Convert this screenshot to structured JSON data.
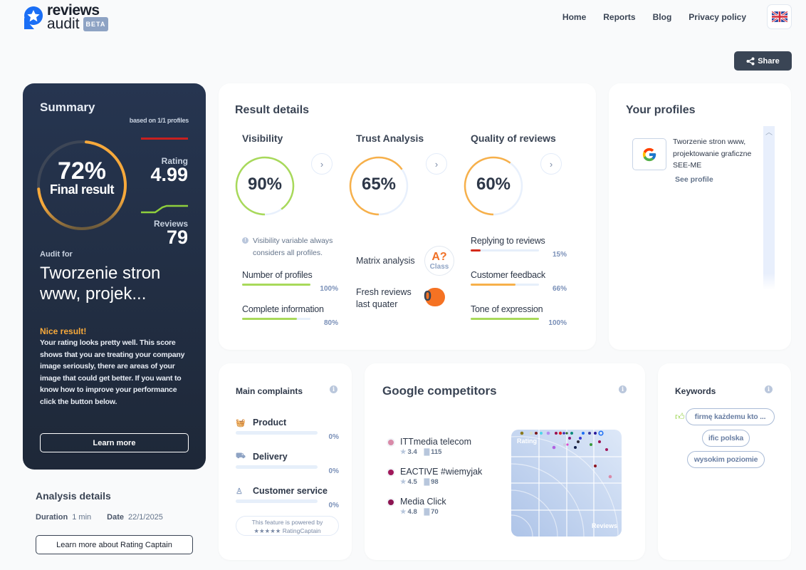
{
  "header": {
    "logo_line1": "reviews",
    "logo_line2": "audit",
    "beta_badge": "BETA",
    "nav": [
      "Home",
      "Reports",
      "Blog",
      "Privacy policy"
    ],
    "language_icon": "uk-flag-icon",
    "share_label": "Share"
  },
  "summary": {
    "title": "Summary",
    "based_on": "based on 1/1 profiles",
    "final_percent": "72%",
    "final_value": 0.72,
    "final_label": "Final result",
    "rating_label": "Rating",
    "rating_value": "4.99",
    "reviews_label": "Reviews",
    "reviews_value": "79",
    "audit_for_label": "Audit for",
    "audit_name": "Tworzenie stron www, projek...",
    "result_heading": "Nice result!",
    "result_text": "Your rating looks pretty well. This score shows that you are treating your company image seriously, there are areas of your image that could get better. If you want to know how to improve your performance click the button below.",
    "learn_more_label": "Learn more",
    "colors": {
      "ring": "#f7a93b",
      "rating_line": "#c8201f",
      "reviews_spark": "#8fcf3c"
    }
  },
  "analysis_details": {
    "title": "Analysis details",
    "duration_label": "Duration",
    "duration_value": "1 min",
    "date_label": "Date",
    "date_value": "22/1/2025",
    "rating_captain_button": "Learn more about Rating Captain"
  },
  "result_details": {
    "title": "Result details",
    "columns": [
      {
        "title": "Visibility",
        "percent": "90%",
        "value": 0.9,
        "color": "#a8d95a"
      },
      {
        "title": "Trust Analysis",
        "percent": "65%",
        "value": 0.65,
        "color": "#f7b04a"
      },
      {
        "title": "Quality of reviews",
        "percent": "60%",
        "value": 0.6,
        "color": "#f7b04a"
      }
    ],
    "visibility_note": "Visibility variable always considers all profiles.",
    "visibility_metrics": [
      {
        "label": "Number of profiles",
        "percent": "100%",
        "value": 1.0,
        "color": "#a8d95a"
      },
      {
        "label": "Complete information",
        "percent": "80%",
        "value": 0.8,
        "color": "#a8d95a"
      }
    ],
    "matrix_label": "Matrix analysis",
    "matrix_grade": "A?",
    "matrix_class": "Class",
    "fresh_label_line1": "Fresh reviews",
    "fresh_label_line2": "last quater",
    "fresh_value": "0",
    "quality_metrics": [
      {
        "label": "Replying to reviews",
        "percent": "15%",
        "value": 0.15,
        "color": "#d42a1a"
      },
      {
        "label": "Customer feedback",
        "percent": "66%",
        "value": 0.66,
        "color": "#f7b04a"
      },
      {
        "label": "Tone of expression",
        "percent": "100%",
        "value": 1.0,
        "color": "#a8d95a"
      }
    ]
  },
  "your_profiles": {
    "title": "Your profiles",
    "profiles": [
      {
        "icon": "google-icon",
        "name": "Tworzenie stron www, projektowanie graficzne SEE-ME",
        "link": "See profile"
      }
    ]
  },
  "main_complaints": {
    "title": "Main complaints",
    "items": [
      {
        "label": "Product",
        "icon": "basket-icon",
        "percent": "0%",
        "value": 0
      },
      {
        "label": "Delivery",
        "icon": "van-icon",
        "percent": "0%",
        "value": 0
      },
      {
        "label": "Customer service",
        "icon": "person-icon",
        "percent": "0%",
        "value": 0
      }
    ],
    "powered_line1": "This feature is powered by",
    "powered_line2": "★★★★★ RatingCaptain"
  },
  "google_competitors": {
    "title": "Google competitors",
    "competitors": [
      {
        "name": "ITTmedia telecom",
        "rating": "3.4",
        "reviews": "115",
        "color": "#d98aa8"
      },
      {
        "name": "EACTIVE #wiemyjak",
        "rating": "4.5",
        "reviews": "98",
        "color": "#a0185a"
      },
      {
        "name": "Media Click",
        "rating": "4.8",
        "reviews": "70",
        "color": "#8c1450"
      }
    ],
    "chart_axis_rating": "Rating",
    "chart_axis_reviews": "Reviews"
  },
  "keywords": {
    "title": "Keywords",
    "chips": [
      "firmę każdemu kto ...",
      "ific polska",
      "wysokim poziomie"
    ]
  }
}
